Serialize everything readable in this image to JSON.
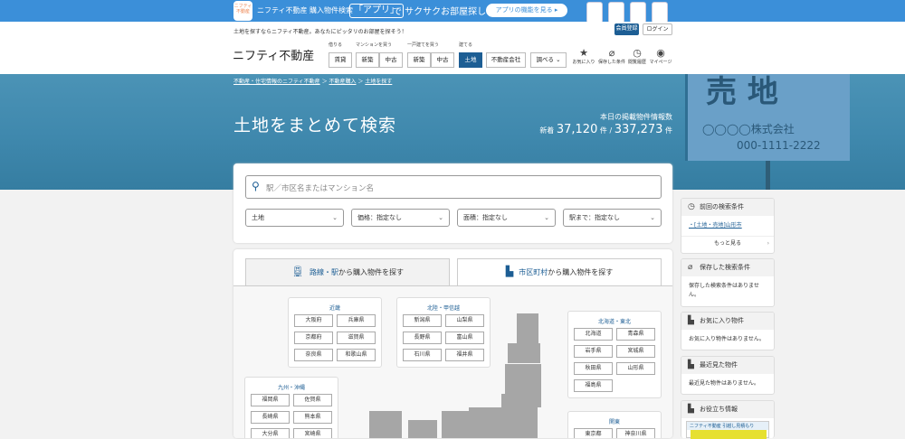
{
  "banner": {
    "app_icon_text": "ニフティ不動産",
    "text1": "ニフティ不動産 購入物件検索",
    "badge": "「アプリ」",
    "text2": "で サクサクお部屋探し",
    "button": "アプリの機能を見る ▸"
  },
  "header": {
    "tagline": "土地を探すならニフティ不動産。あなたにピッタリのお部屋を探そう！",
    "register": "会員登録",
    "login": "ログイン",
    "logo": "ニフティ不動産",
    "nav_captions": [
      "借りる",
      "マンションを買う",
      "一戸建てを買う",
      "建てる"
    ],
    "nav": {
      "rent": "賃貸",
      "mansion_new": "新築",
      "mansion_used": "中古",
      "house_new": "新築",
      "house_used": "中古",
      "land": "土地",
      "agency": "不動産会社",
      "lookup": "調べる"
    },
    "icons": [
      {
        "name": "star",
        "label": "お気に入り"
      },
      {
        "name": "clip",
        "label": "保存した条件"
      },
      {
        "name": "clock",
        "label": "閲覧履歴"
      },
      {
        "name": "user",
        "label": "マイページ"
      }
    ]
  },
  "hero": {
    "crumbs": [
      "不動産・住宅情報のニフティ不動産",
      "不動産購入",
      "土地を探す"
    ],
    "title": "土地をまとめて検索",
    "count_caption": "本日の掲載物件情報数",
    "new_label": "新着",
    "new_count": "37,120",
    "unit": "件",
    "total": "337,273",
    "sign_big": "売 地",
    "sign_company": "◯◯◯◯株式会社",
    "sign_tel": "000-1111-2222"
  },
  "search": {
    "placeholder": "駅／市区名またはマンション名",
    "selects": [
      "土地",
      "価格：指定なし",
      "面積：指定なし",
      "駅まで：指定なし"
    ]
  },
  "tabs": {
    "line_strong": "路線・駅",
    "line_rest": "から購入物件を探す",
    "city_strong": "市区町村",
    "city_rest": "から購入物件を探す"
  },
  "regions": {
    "kinki": {
      "title": "近畿",
      "prefs": [
        "大阪府",
        "兵庫県",
        "京都府",
        "滋賀県",
        "奈良県",
        "和歌山県"
      ]
    },
    "hokuriku": {
      "title": "北陸・甲信越",
      "prefs": [
        "新潟県",
        "山梨県",
        "長野県",
        "富山県",
        "石川県",
        "福井県"
      ]
    },
    "hokkaido": {
      "title": "北海道・東北",
      "prefs": [
        "北海道",
        "青森県",
        "岩手県",
        "宮城県",
        "秋田県",
        "山形県",
        "福島県"
      ]
    },
    "kyushu": {
      "title": "九州・沖縄",
      "prefs": [
        "福岡県",
        "佐賀県",
        "長崎県",
        "熊本県",
        "大分県",
        "宮崎県"
      ]
    },
    "kanto": {
      "title": "関東",
      "prefs": [
        "東京都",
        "神奈川県"
      ]
    }
  },
  "sidebar": {
    "last_title": "前回の検索条件",
    "last_item": "・[土地・売地]山形市",
    "more": "もっと見る",
    "saved_title": "保存した検索条件",
    "saved_body": "保存した検索条件はありません。",
    "fav_title": "お気に入り物件",
    "fav_body": "お気に入り物件はありません。",
    "recent_title": "最近見た物件",
    "recent_body": "最近見た物件はありません。",
    "useful_title": "お役立ち情報",
    "ad_text": "ニフティ不動産 引越し見積もり"
  }
}
